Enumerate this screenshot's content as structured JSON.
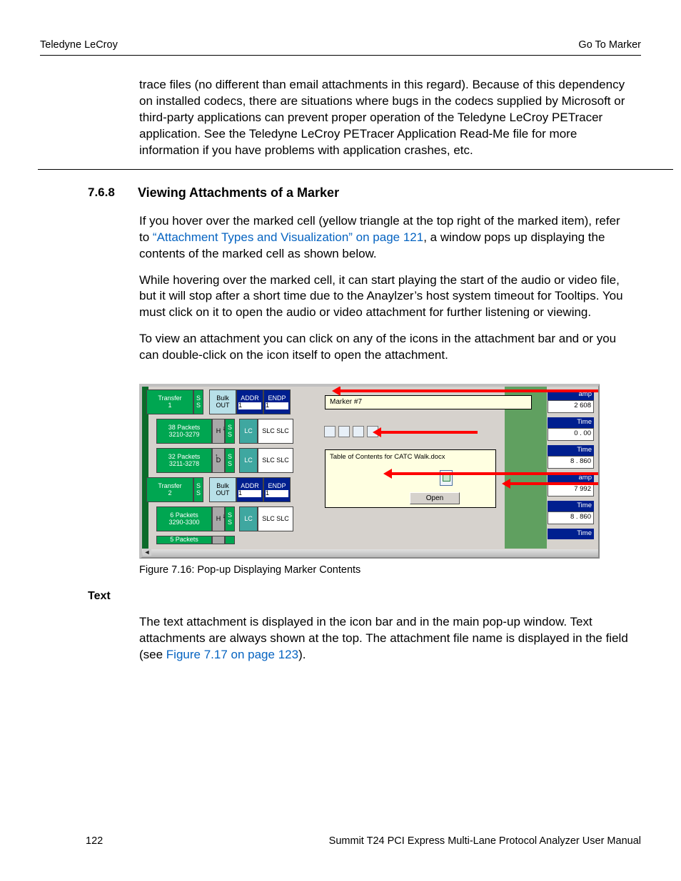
{
  "header": {
    "left": "Teledyne LeCroy",
    "right": "Go To Marker"
  },
  "intro_para": "trace files (no different than email attachments in this regard). Because of this dependency on installed codecs, there are situations where bugs in the codecs supplied by Microsoft or third-party applications can prevent proper operation of the Teledyne LeCroy PETracer application. See the Teledyne LeCroy PETracer Application Read-Me file for more information if you have problems with application crashes, etc.",
  "section": {
    "num": "7.6.8",
    "title": "Viewing Attachments of a Marker"
  },
  "p1a": "If you hover over the marked cell (yellow triangle at the top right of the marked item), refer to ",
  "p1_link": "“Attachment Types and Visualization” on page 121",
  "p1b": ", a window pops up displaying the contents of the marked cell as shown below.",
  "p2": "While hovering over the marked cell, it can start playing the start of the audio or video file, but it will stop after a short time due to the Anaylzer’s host system timeout for Tooltips. You must click on it to open the audio or video attachment for further listening or viewing.",
  "p3": "To view an attachment you can click on any of the icons in the attachment bar and or you can double-click on the icon itself to open the attachment.",
  "figure": {
    "marker_label": "Marker #7",
    "popup_filename": "Table of Contents for CATC Walk.docx",
    "open_label": "Open",
    "rows": [
      {
        "c1a": "Transfer",
        "c1b": "1",
        "s": "S",
        "type": "Bulk",
        "dir": "OUT",
        "addr": "ADDR",
        "addrv": "1",
        "endp": "ENDP",
        "endpv": "1"
      },
      {
        "c1a": "38 Packets",
        "c1b": "3210-3279",
        "mid": "H",
        "lc": "LC",
        "slc": "SLC SLC"
      },
      {
        "c1a": "32 Packets",
        "c1b": "3211-3278",
        "mid": "D",
        "lc": "LC",
        "slc": "SLC SLC"
      },
      {
        "c1a": "Transfer",
        "c1b": "2",
        "s": "S",
        "type": "Bulk",
        "dir": "OUT",
        "addr": "ADDR",
        "addrv": "1",
        "endp": "ENDP",
        "endpv": "1"
      },
      {
        "c1a": "6 Packets",
        "c1b": "3290-3300",
        "mid": "H",
        "lc": "LC",
        "slc": "SLC SLC"
      },
      {
        "c1a": "5 Packets",
        "c1b": ""
      }
    ],
    "right": [
      {
        "head": "amp",
        "val": "2 608"
      },
      {
        "head": "Time",
        "val": "0 . 00"
      },
      {
        "head": "Time",
        "val": "8 . 860"
      },
      {
        "head": "amp",
        "val": "7 992"
      },
      {
        "head": "Time",
        "val": "8 . 860"
      },
      {
        "head": "Time",
        "val": ""
      }
    ]
  },
  "caption": "Figure 7.16:  Pop-up Displaying Marker Contents",
  "sub_head": "Text",
  "p4a": "The text attachment is displayed in the icon bar and in the main pop-up window. Text attachments are always shown at the top. The attachment file name is displayed in the field (see ",
  "p4_link": "Figure 7.17 on page 123",
  "p4b": ").",
  "footer": {
    "page": "122",
    "title": "Summit T24 PCI Express Multi-Lane Protocol Analyzer User Manual"
  }
}
